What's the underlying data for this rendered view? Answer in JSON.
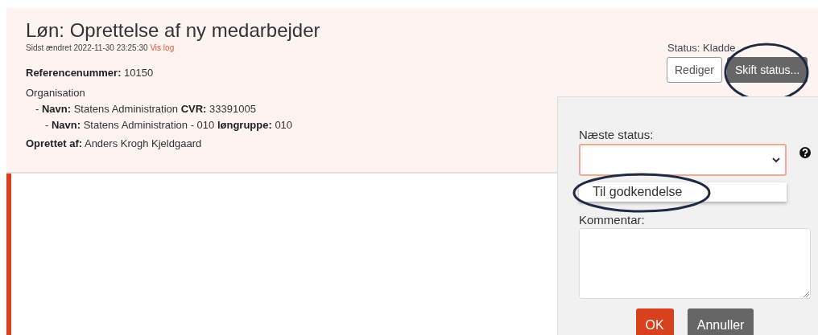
{
  "header": {
    "title": "Løn: Oprettelse af ny medarbejder",
    "modified": "Sidst ændret 2022-11-30 23:25:30",
    "log_link": "Vis log",
    "reference": "**Referencenummer:** 10150",
    "organisation": {
      "label": "Organisation",
      "children": [
        {
          "text": "- **Navn:** Statens Administration **CVR:** 33391005",
          "children": [
            {
              "text": "- **Navn:** Statens Administration - 010 **løngruppe:** 010"
            }
          ]
        }
      ]
    },
    "created_by": "**Oprettet af:** Anders Krogh Kjeldgaard"
  },
  "status": {
    "text": "Status: Kladde",
    "buttons": [
      {
        "label": "Rediger",
        "kind": "outline",
        "highlighted": false
      },
      {
        "label": "Skift status...",
        "kind": "dark",
        "highlighted": true
      }
    ]
  },
  "popover": {
    "next_status_label": "Næste status:",
    "options": [
      {
        "label": "Til godkendelse",
        "selected": false,
        "highlighted": true
      }
    ],
    "comment_label": "Kommentar:",
    "actions": [
      {
        "label": "OK",
        "kind": "primary"
      },
      {
        "label": "Annuller",
        "kind": "secondary"
      }
    ]
  }
}
